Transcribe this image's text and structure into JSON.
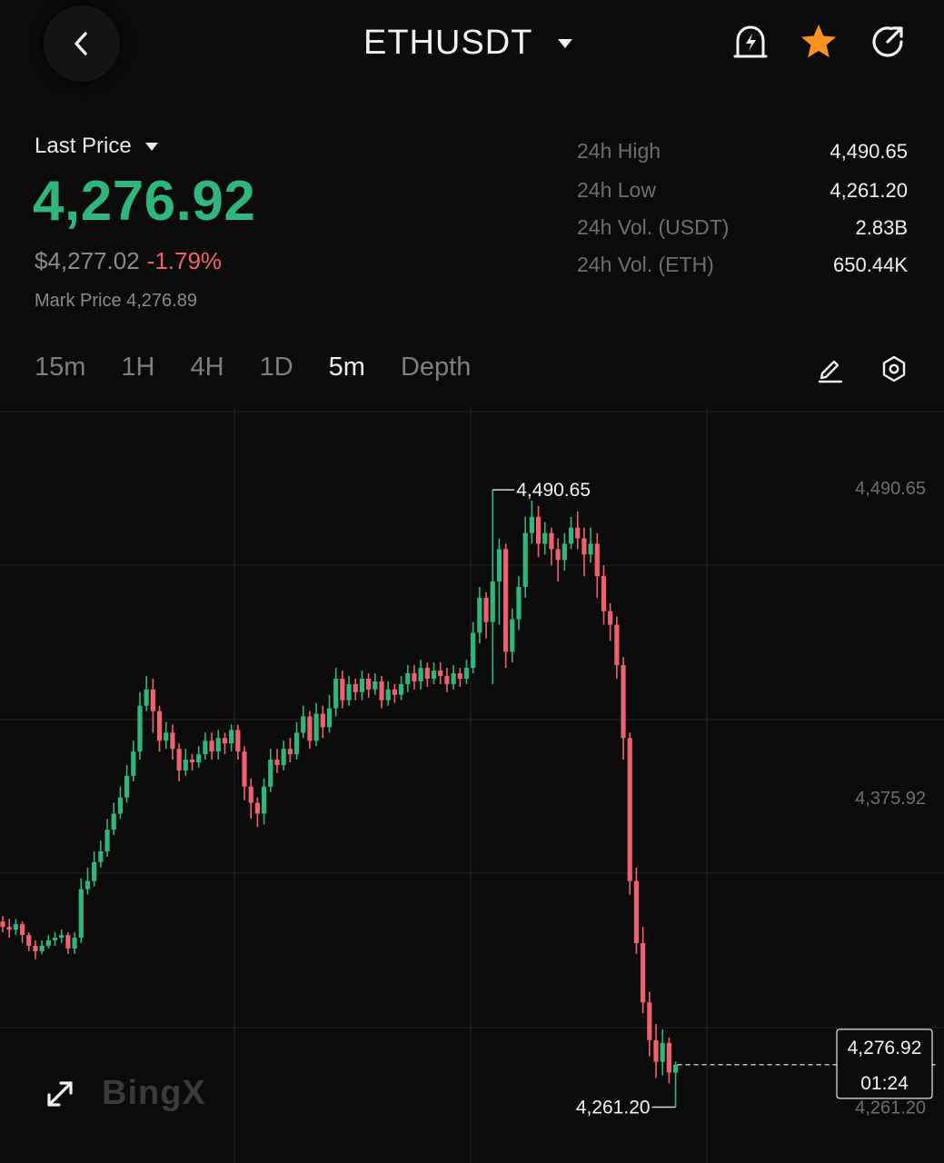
{
  "header": {
    "title": "ETHUSDT"
  },
  "price": {
    "label": "Last Price",
    "last": "4,276.92",
    "usd": "$4,277.02",
    "change": "-1.79%",
    "mark": "Mark Price 4,276.89"
  },
  "stats": [
    {
      "label": "24h High",
      "value": "4,490.65"
    },
    {
      "label": "24h Low",
      "value": "4,261.20"
    },
    {
      "label": "24h Vol. (USDT)",
      "value": "2.83B"
    },
    {
      "label": "24h Vol. (ETH)",
      "value": "650.44K"
    }
  ],
  "tabs": [
    "15m",
    "1H",
    "4H",
    "1D",
    "5m",
    "Depth"
  ],
  "active_tab": "5m",
  "colors": {
    "up": "#2eb67d",
    "down": "#f0616d",
    "accent_star": "#f7931e"
  },
  "logo_text": "BingX",
  "chart_data": {
    "type": "candlestick",
    "y_tick_labels": [
      "4,490.65",
      "4,375.92",
      "4,261.20"
    ],
    "y_ticks": [
      4490.65,
      4375.92,
      4261.2
    ],
    "ylim": [
      4240.5,
      4520.0
    ],
    "high_label": "4,490.65",
    "low_label": "4,261.20",
    "current_price": "4,276.92",
    "current_value": 4276.92,
    "countdown": "01:24",
    "grid": true,
    "candles": [
      [
        4330,
        4328,
        4332,
        4326
      ],
      [
        4328,
        4327,
        4331,
        4324
      ],
      [
        4327,
        4329,
        4331,
        4325
      ],
      [
        4329,
        4325,
        4330,
        4322
      ],
      [
        4325,
        4321,
        4326,
        4319
      ],
      [
        4321,
        4319,
        4323,
        4316
      ],
      [
        4319,
        4321,
        4323,
        4318
      ],
      [
        4321,
        4323,
        4325,
        4320
      ],
      [
        4323,
        4324,
        4326,
        4321
      ],
      [
        4324,
        4325,
        4327,
        4322
      ],
      [
        4325,
        4320,
        4326,
        4318
      ],
      [
        4320,
        4324,
        4326,
        4318
      ],
      [
        4324,
        4342,
        4346,
        4322
      ],
      [
        4342,
        4345,
        4350,
        4340
      ],
      [
        4345,
        4352,
        4356,
        4343
      ],
      [
        4352,
        4356,
        4360,
        4350
      ],
      [
        4356,
        4364,
        4368,
        4354
      ],
      [
        4364,
        4370,
        4374,
        4362
      ],
      [
        4370,
        4376,
        4380,
        4368
      ],
      [
        4376,
        4384,
        4388,
        4374
      ],
      [
        4384,
        4393,
        4397,
        4382
      ],
      [
        4393,
        4410,
        4415,
        4390
      ],
      [
        4410,
        4416,
        4421,
        4408
      ],
      [
        4416,
        4408,
        4420,
        4400
      ],
      [
        4408,
        4397,
        4410,
        4393
      ],
      [
        4397,
        4400,
        4404,
        4394
      ],
      [
        4400,
        4394,
        4403,
        4390
      ],
      [
        4394,
        4386,
        4396,
        4382
      ],
      [
        4386,
        4390,
        4394,
        4384
      ],
      [
        4390,
        4389,
        4392,
        4386
      ],
      [
        4389,
        4392,
        4395,
        4387
      ],
      [
        4392,
        4397,
        4400,
        4390
      ],
      [
        4397,
        4393,
        4400,
        4390
      ],
      [
        4393,
        4398,
        4401,
        4390
      ],
      [
        4398,
        4396,
        4400,
        4392
      ],
      [
        4396,
        4401,
        4403,
        4393
      ],
      [
        4401,
        4393,
        4403,
        4390
      ],
      [
        4393,
        4380,
        4395,
        4375
      ],
      [
        4380,
        4374,
        4383,
        4368
      ],
      [
        4374,
        4370,
        4376,
        4365
      ],
      [
        4370,
        4380,
        4383,
        4366
      ],
      [
        4380,
        4390,
        4394,
        4378
      ],
      [
        4390,
        4388,
        4394,
        4385
      ],
      [
        4388,
        4394,
        4397,
        4386
      ],
      [
        4394,
        4392,
        4398,
        4389
      ],
      [
        4392,
        4400,
        4404,
        4390
      ],
      [
        4400,
        4406,
        4410,
        4398
      ],
      [
        4406,
        4397,
        4408,
        4394
      ],
      [
        4397,
        4407,
        4411,
        4395
      ],
      [
        4407,
        4402,
        4410,
        4398
      ],
      [
        4402,
        4409,
        4414,
        4400
      ],
      [
        4409,
        4420,
        4424,
        4406
      ],
      [
        4420,
        4412,
        4423,
        4409
      ],
      [
        4412,
        4418,
        4421,
        4410
      ],
      [
        4418,
        4415,
        4420,
        4412
      ],
      [
        4415,
        4420,
        4423,
        4412
      ],
      [
        4420,
        4416,
        4422,
        4413
      ],
      [
        4416,
        4419,
        4422,
        4414
      ],
      [
        4419,
        4412,
        4421,
        4409
      ],
      [
        4412,
        4416,
        4419,
        4410
      ],
      [
        4416,
        4414,
        4418,
        4411
      ],
      [
        4414,
        4418,
        4421,
        4412
      ],
      [
        4418,
        4422,
        4425,
        4415
      ],
      [
        4422,
        4419,
        4425,
        4416
      ],
      [
        4419,
        4424,
        4427,
        4416
      ],
      [
        4424,
        4420,
        4426,
        4417
      ],
      [
        4420,
        4423,
        4426,
        4418
      ],
      [
        4423,
        4421,
        4426,
        4418
      ],
      [
        4421,
        4418,
        4424,
        4415
      ],
      [
        4418,
        4422,
        4425,
        4416
      ],
      [
        4422,
        4420,
        4424,
        4417
      ],
      [
        4420,
        4424,
        4427,
        4418
      ],
      [
        4424,
        4437,
        4441,
        4422
      ],
      [
        4437,
        4450,
        4454,
        4433
      ],
      [
        4450,
        4441,
        4452,
        4435
      ],
      [
        4441,
        4456,
        4490,
        4418
      ],
      [
        4456,
        4468,
        4472,
        4440
      ],
      [
        4468,
        4430,
        4470,
        4424
      ],
      [
        4430,
        4442,
        4446,
        4426
      ],
      [
        4442,
        4454,
        4458,
        4438
      ],
      [
        4454,
        4474,
        4480,
        4450
      ],
      [
        4474,
        4480,
        4486,
        4470
      ],
      [
        4480,
        4470,
        4484,
        4465
      ],
      [
        4470,
        4474,
        4478,
        4466
      ],
      [
        4474,
        4468,
        4476,
        4462
      ],
      [
        4468,
        4464,
        4472,
        4456
      ],
      [
        4464,
        4470,
        4474,
        4460
      ],
      [
        4470,
        4476,
        4480,
        4468
      ],
      [
        4476,
        4472,
        4482,
        4468
      ],
      [
        4472,
        4466,
        4476,
        4458
      ],
      [
        4466,
        4470,
        4476,
        4463
      ],
      [
        4470,
        4458,
        4474,
        4450
      ],
      [
        4458,
        4445,
        4462,
        4440
      ],
      [
        4445,
        4440,
        4448,
        4434
      ],
      [
        4440,
        4425,
        4443,
        4420
      ],
      [
        4425,
        4398,
        4428,
        4390
      ],
      [
        4398,
        4345,
        4400,
        4340
      ],
      [
        4345,
        4322,
        4350,
        4318
      ],
      [
        4322,
        4300,
        4328,
        4296
      ],
      [
        4300,
        4286,
        4304,
        4280
      ],
      [
        4286,
        4278,
        4292,
        4272
      ],
      [
        4278,
        4285,
        4290,
        4273
      ],
      [
        4285,
        4274,
        4287,
        4270
      ],
      [
        4274,
        4276.92,
        4278,
        4261.2
      ]
    ]
  }
}
